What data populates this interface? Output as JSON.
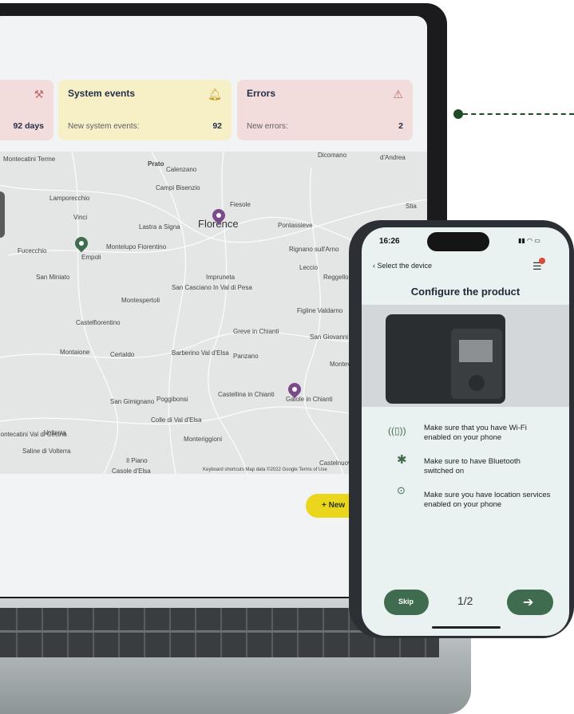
{
  "dashboard": {
    "cards": [
      {
        "title": "",
        "sub": "",
        "value": "92 days",
        "color": "#f2dcdc",
        "icon": "wrench-icon"
      },
      {
        "title": "System events",
        "sub": "New system events:",
        "value": "92",
        "color": "#f7efc6",
        "icon": "bell-icon"
      },
      {
        "title": "Errors",
        "sub": "New errors:",
        "value": "2",
        "color": "#f2dcdc",
        "icon": "warning-icon"
      }
    ],
    "new_button_label": "+ New",
    "map": {
      "towns": [
        "Montecatini Terme",
        "Prato",
        "Calenzano",
        "Campi Bisenzio",
        "Lamporecchio",
        "Vinci",
        "Fiesole",
        "Lastra a Signa",
        "Florence",
        "Pontassieve",
        "Dicomano",
        "d'Andrea",
        "Stia",
        "Fucecchio",
        "Empoli",
        "Montelupo Fiorentino",
        "Rignano sull'Arno",
        "Leccio",
        "Reggello",
        "San Miniato",
        "Impruneta",
        "San Casciano In Val di Pesa",
        "Montespertoli",
        "Figline Valdarno",
        "Castelfiorentino",
        "Greve in Chianti",
        "San Giovanni Valdarno",
        "Montaione",
        "Certaldo",
        "Barberino Val d'Elsa",
        "Panzano",
        "San Gimignano",
        "Poggibonsi",
        "Castellina in Chianti",
        "Gaiole in Chianti",
        "Colle di Val d'Elsa",
        "Monteriggioni",
        "Montecatini Val di Cecina",
        "Volterra",
        "Saline di Volterra",
        "Il Piano",
        "Casole d'Elsa",
        "Castelnuovo",
        "Montevarchi"
      ],
      "footer": "Keyboard shortcuts   Map data ©2022 Google   Terms of Use"
    }
  },
  "phone": {
    "time": "16:26",
    "back_label": "Select the device",
    "title": "Configure the product",
    "items": [
      {
        "icon": "phone-wifi-icon",
        "text": "Make sure that you have Wi-Fi enabled on your phone"
      },
      {
        "icon": "bluetooth-icon",
        "text": "Make sure to have Bluetooth switched on"
      },
      {
        "icon": "location-pin-icon",
        "text": "Make sure you have location services enabled on your phone"
      }
    ],
    "skip_label": "Skip",
    "page_indicator": "1/2",
    "next_icon": "arrow-right-icon",
    "accent": "#3f6b4e"
  }
}
